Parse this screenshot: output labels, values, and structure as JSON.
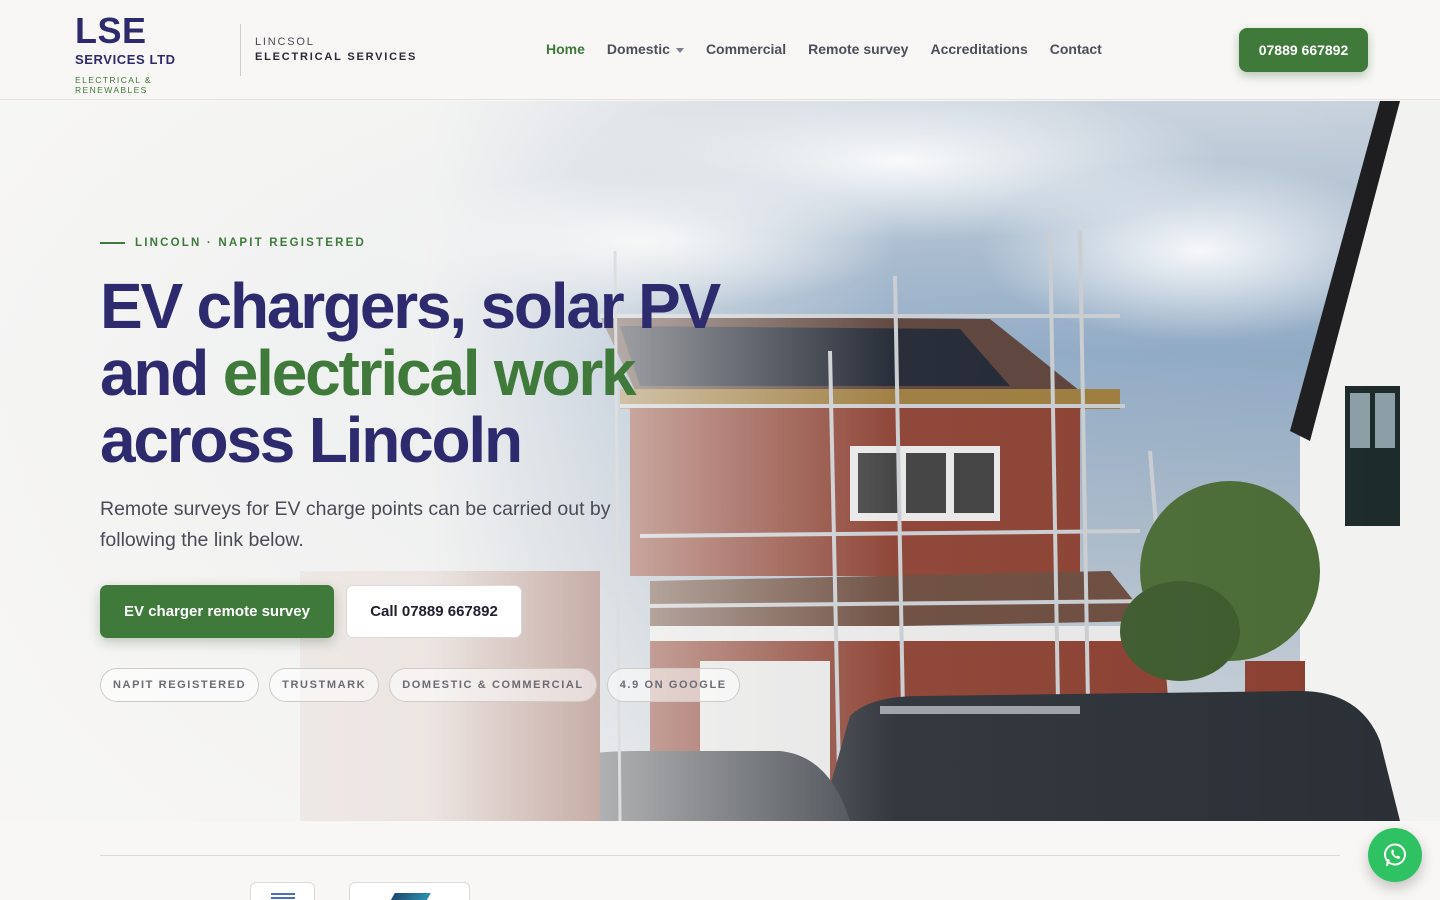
{
  "header": {
    "logo_main": "LSE",
    "logo_sub": "SERVICES LTD",
    "logo_tag": "ELECTRICAL & RENEWABLES",
    "brand_line1": "LINCSOL",
    "brand_line2": "ELECTRICAL SERVICES",
    "nav": [
      {
        "label": "Home",
        "active": true
      },
      {
        "label": "Domestic",
        "has_dropdown": true
      },
      {
        "label": "Commercial"
      },
      {
        "label": "Remote survey"
      },
      {
        "label": "Accreditations"
      },
      {
        "label": "Contact"
      }
    ],
    "call_label": "07889 667892"
  },
  "hero": {
    "eyebrow": "LINCOLN · NAPIT REGISTERED",
    "headline_part1": "EV chargers, solar PV and ",
    "headline_green1": "electrical work",
    "headline_part2": " across Lincoln",
    "lede": "Remote surveys for EV charge points can be carried out by following the link below.",
    "primary_cta": "EV charger remote survey",
    "secondary_cta": "Call 07889 667892",
    "badges": [
      "NAPIT REGISTERED",
      "TRUSTMARK",
      "DOMESTIC & COMMERCIAL",
      "4.9 ON GOOGLE"
    ]
  },
  "colors": {
    "brand_navy": "#2d2b6e",
    "brand_green": "#3f7a3b",
    "whatsapp_green": "#2fc262"
  },
  "icons": {
    "whatsapp": "whatsapp-icon",
    "dropdown": "chevron-down-icon"
  }
}
